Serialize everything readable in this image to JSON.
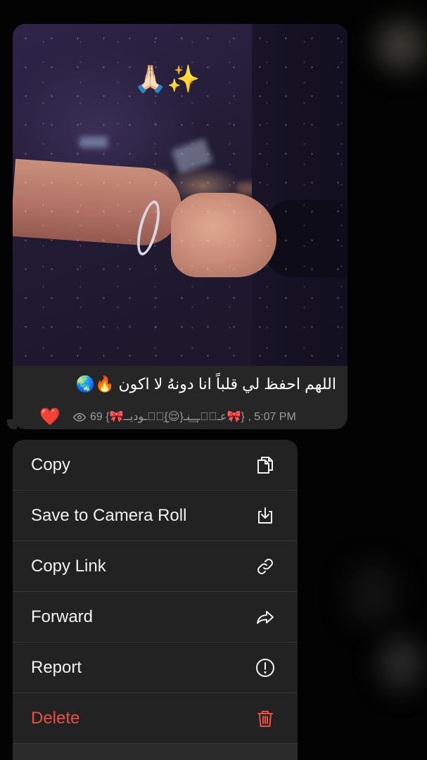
{
  "message": {
    "photo_emoji": "🙏🏻✨",
    "caption": "اللهم احفظ لي قلباً انا دونهُ لا اكون 🔥🌏",
    "reaction": "❤️",
    "views_icon": "eye-icon",
    "meta": "69 {🎀عــᷞــ͢ـنـ{😌}͢ـᷞـوديــ🎀} , 5:07 PM"
  },
  "menu": {
    "items": [
      {
        "label": "Copy",
        "icon": "copy-icon"
      },
      {
        "label": "Save to Camera Roll",
        "icon": "save-download-icon"
      },
      {
        "label": "Copy Link",
        "icon": "link-icon"
      },
      {
        "label": "Forward",
        "icon": "forward-arrow-icon"
      },
      {
        "label": "Report",
        "icon": "alert-circle-icon"
      },
      {
        "label": "Delete",
        "icon": "trash-icon"
      }
    ]
  },
  "colors": {
    "background": "#000000",
    "bubble": "#272627",
    "menu": "#222223",
    "danger": "#E9503F",
    "meta_text": "#9B9B9F"
  }
}
